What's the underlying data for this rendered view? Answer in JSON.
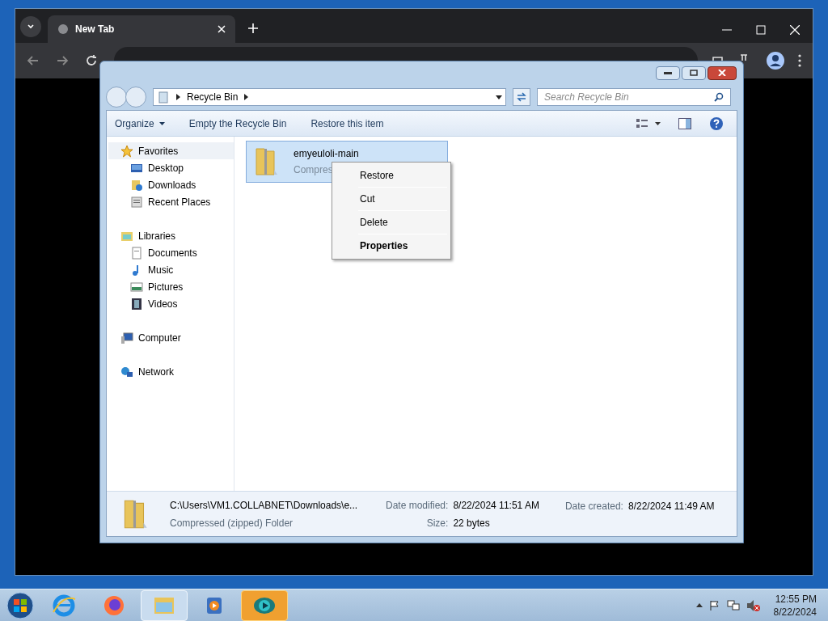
{
  "browser": {
    "tabs": [
      {
        "title": "New Tab",
        "selected": true
      }
    ]
  },
  "explorer": {
    "breadcrumb": [
      "Recycle Bin"
    ],
    "search_placeholder": "Search Recycle Bin",
    "toolbar": [
      {
        "label": "Organize",
        "kind": "menu"
      },
      {
        "label": "Empty the Recycle Bin",
        "kind": "plain"
      },
      {
        "label": "Restore this item",
        "kind": "plain"
      }
    ],
    "nav": [
      {
        "label": "Favorites",
        "kind": "star",
        "children": [
          {
            "label": "Desktop",
            "kind": "desktop"
          },
          {
            "label": "Downloads",
            "kind": "downloads"
          },
          {
            "label": "Recent Places",
            "kind": "recent"
          }
        ]
      },
      {
        "label": "Libraries",
        "kind": "libraries",
        "children": [
          {
            "label": "Documents",
            "kind": "documents"
          },
          {
            "label": "Music",
            "kind": "music"
          },
          {
            "label": "Pictures",
            "kind": "pictures"
          },
          {
            "label": "Videos",
            "kind": "videos"
          }
        ]
      },
      {
        "label": "Computer",
        "kind": "computer"
      },
      {
        "label": "Network",
        "kind": "network"
      }
    ],
    "files": [
      {
        "name": "emyeuloli-main",
        "type": "Compres",
        "selected": true
      }
    ],
    "details": {
      "path": "C:\\Users\\VM1.COLLABNET\\Downloads\\e...",
      "type": "Compressed (zipped) Folder",
      "fields": [
        {
          "label": "Date modified:",
          "value": "8/22/2024 11:51 AM"
        },
        {
          "label": "Date created:",
          "value": "8/22/2024 11:49 AM"
        },
        {
          "label": "Size:",
          "value": "22 bytes"
        }
      ]
    }
  },
  "context_menu": [
    {
      "label": "Restore",
      "bold": false
    },
    {
      "label": "Cut",
      "bold": false
    },
    {
      "label": "Delete",
      "bold": false
    },
    {
      "label": "Properties",
      "bold": true
    }
  ],
  "taskbar": {
    "apps": [
      {
        "kind": "ie",
        "active": false,
        "attention": false
      },
      {
        "kind": "firefox",
        "active": false,
        "attention": false
      },
      {
        "kind": "explorer",
        "active": true,
        "attention": false
      },
      {
        "kind": "media",
        "active": false,
        "attention": false
      },
      {
        "kind": "viewer",
        "active": false,
        "attention": true
      }
    ],
    "time": "12:55 PM",
    "date": "8/22/2024"
  }
}
